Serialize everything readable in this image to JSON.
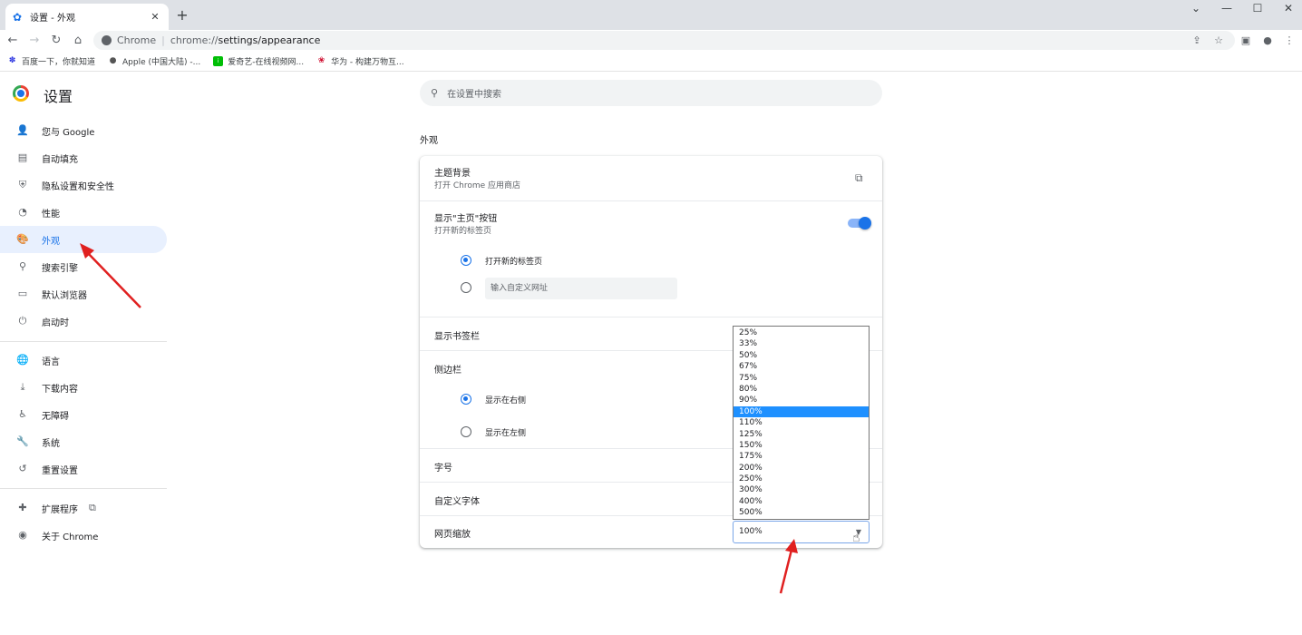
{
  "tab": {
    "title": "设置 - 外观",
    "close": "✕"
  },
  "toolbar": {
    "chrome_label": "Chrome",
    "url_scheme": "chrome://",
    "url_path": "settings/appearance"
  },
  "bookmarks": [
    {
      "label": "百度一下，你就知道",
      "icon": "baidu-icon",
      "color": "#2932e1"
    },
    {
      "label": "Apple (中国大陆) -...",
      "icon": "apple-icon",
      "color": "#555555"
    },
    {
      "label": "爱奇艺-在线视频网...",
      "icon": "iqiyi-icon",
      "color": "#00be06"
    },
    {
      "label": "华为 - 构建万物互...",
      "icon": "huawei-icon",
      "color": "#cf0a2c"
    }
  ],
  "sidebar": {
    "title": "设置",
    "items": [
      {
        "label": "您与 Google",
        "icon": "person-icon"
      },
      {
        "label": "自动填充",
        "icon": "clipboard-icon"
      },
      {
        "label": "隐私设置和安全性",
        "icon": "shield-icon"
      },
      {
        "label": "性能",
        "icon": "speedometer-icon"
      },
      {
        "label": "外观",
        "icon": "palette-icon"
      },
      {
        "label": "搜索引擎",
        "icon": "search-icon"
      },
      {
        "label": "默认浏览器",
        "icon": "browser-icon"
      },
      {
        "label": "启动时",
        "icon": "power-icon"
      },
      {
        "label": "语言",
        "icon": "globe-icon"
      },
      {
        "label": "下载内容",
        "icon": "download-icon"
      },
      {
        "label": "无障碍",
        "icon": "accessibility-icon"
      },
      {
        "label": "系统",
        "icon": "wrench-icon"
      },
      {
        "label": "重置设置",
        "icon": "reset-icon"
      },
      {
        "label": "扩展程序",
        "icon": "puzzle-icon"
      },
      {
        "label": "关于 Chrome",
        "icon": "chrome-icon"
      }
    ]
  },
  "search": {
    "placeholder": "在设置中搜索"
  },
  "main": {
    "section_title": "外观",
    "theme": {
      "label": "主题背景",
      "sub": "打开 Chrome 应用商店"
    },
    "home_button": {
      "label": "显示\"主页\"按钮",
      "sub": "打开新的标签页",
      "enabled": true
    },
    "home_options": {
      "new_tab": "打开新的标签页",
      "custom_url_placeholder": "输入自定义网址"
    },
    "bookmarks_bar": {
      "label": "显示书签栏"
    },
    "side_panel": {
      "label": "侧边栏",
      "right": "显示在右侧",
      "left": "显示在左侧"
    },
    "font_size": {
      "label": "字号"
    },
    "custom_fonts": {
      "label": "自定义字体"
    },
    "zoom": {
      "label": "网页缩放",
      "value": "100%",
      "options": [
        "25%",
        "33%",
        "50%",
        "67%",
        "75%",
        "80%",
        "90%",
        "100%",
        "110%",
        "125%",
        "150%",
        "175%",
        "200%",
        "250%",
        "300%",
        "400%",
        "500%"
      ]
    }
  },
  "colors": {
    "accent": "#1a73e8",
    "active_bg": "#e8f0fe",
    "annotation_arrow": "#e02020"
  }
}
